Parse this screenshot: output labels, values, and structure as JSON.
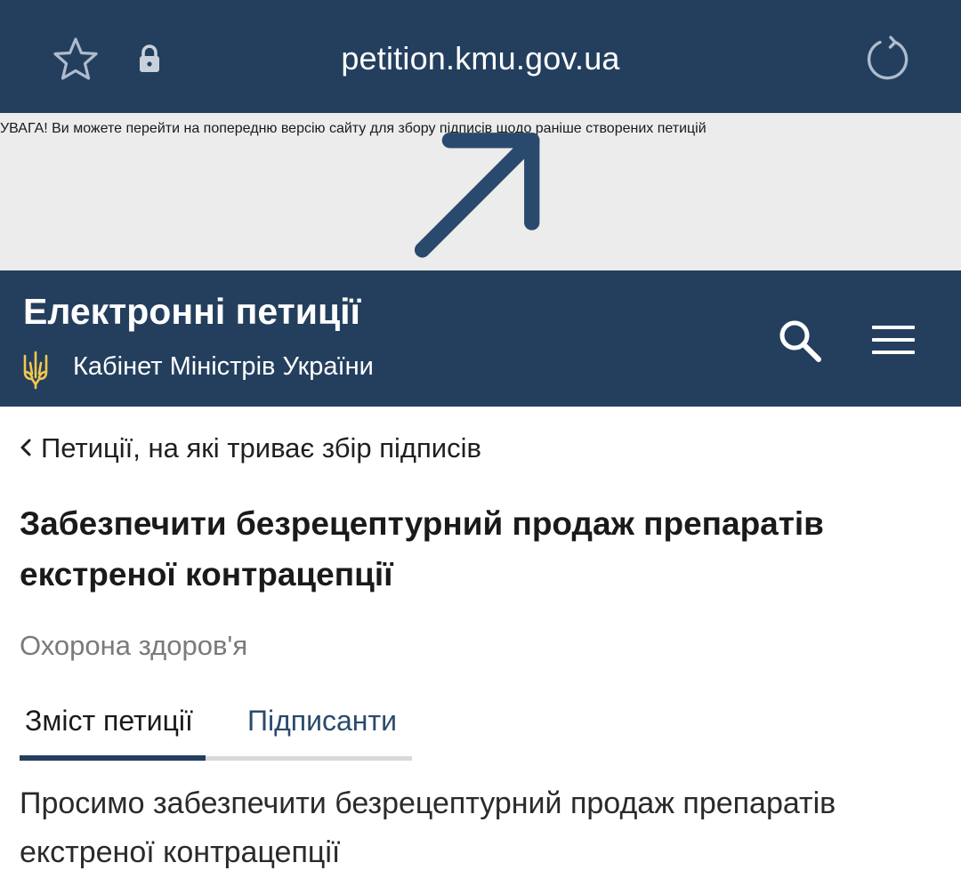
{
  "browser": {
    "url": "petition.kmu.gov.ua",
    "icons": [
      "star-icon",
      "lock-icon",
      "reload-icon"
    ],
    "bar_color": "#243f5e"
  },
  "notice": {
    "text": "УВАГА! Ви можете перейти на попередню версію сайту для збору підписів щодо раніше створених петицій",
    "icon": "arrow-up-right-icon",
    "text_color": "#2a4a6d"
  },
  "header": {
    "title": "Електронні петиції",
    "subtitle": "Кабінет Міністрів України",
    "icons": [
      "trident-icon",
      "search-icon",
      "menu-icon"
    ],
    "background": "#243f5e",
    "emblem_color": "#f2c94c"
  },
  "breadcrumb": {
    "back_label": "Петиції, на які триває збір підписів"
  },
  "petition": {
    "title": "Забезпечити безрецептурний продаж препаратів екстреної контрацепції",
    "category": "Охорона здоров'я",
    "body": "Просимо забезпечити безрецептурний продаж препаратів екстреної контрацепції"
  },
  "tabs": [
    {
      "label": "Зміст петиції",
      "active": true
    },
    {
      "label": "Підписанти",
      "active": false
    }
  ]
}
